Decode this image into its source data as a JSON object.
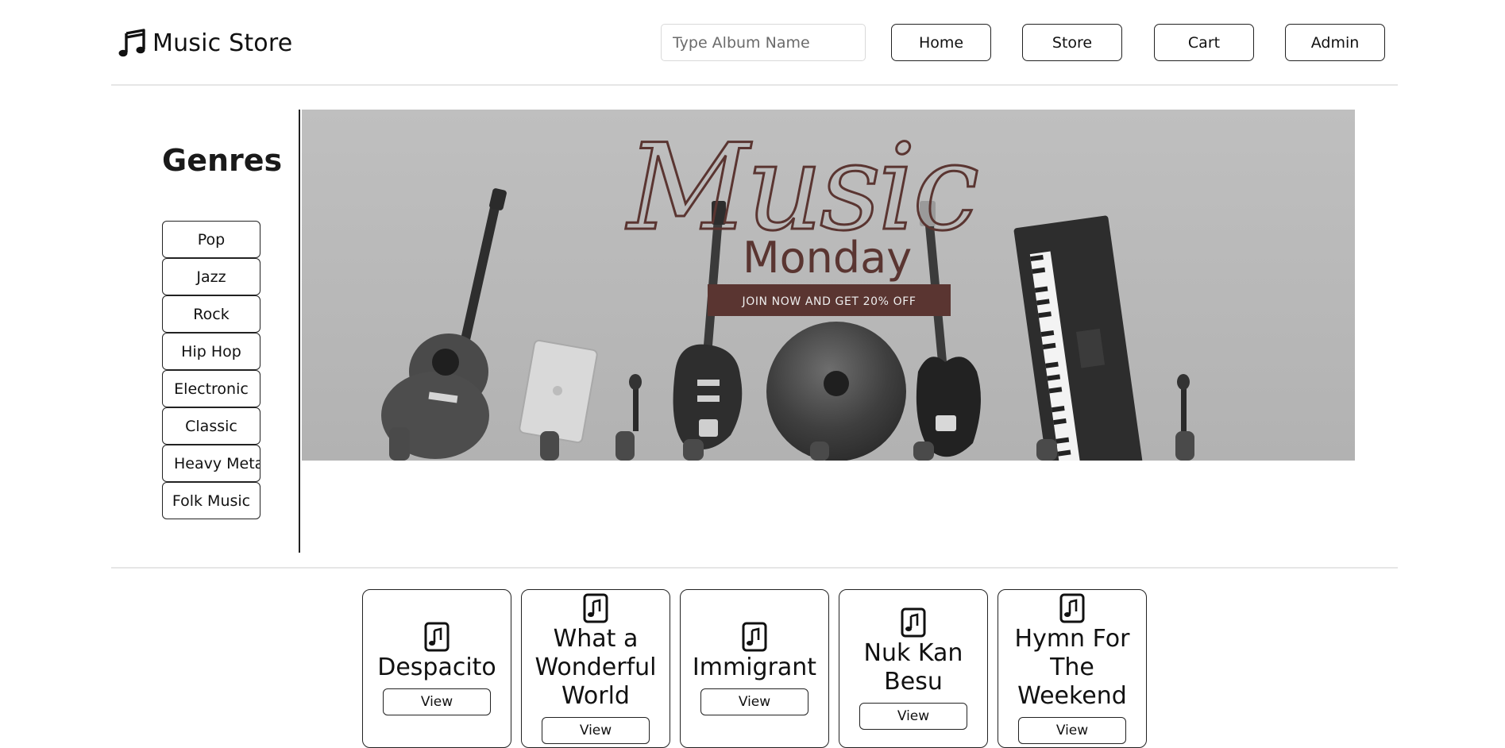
{
  "brand": {
    "name": "Music Store",
    "icon": "music-note-icon"
  },
  "search": {
    "placeholder": "Type Album Name"
  },
  "nav": {
    "home": "Home",
    "store": "Store",
    "cart": "Cart",
    "admin": "Admin"
  },
  "sidebar": {
    "title": "Genres",
    "genres": [
      "Pop",
      "Jazz",
      "Rock",
      "Hip Hop",
      "Electronic",
      "Classic",
      "Heavy Metal",
      "Folk Music"
    ]
  },
  "banner": {
    "script_text": "Music",
    "title": "Monday",
    "cta": "JOIN NOW AND GET 20% OFF"
  },
  "albums": [
    {
      "title": "Despacito",
      "icon": "music-file-icon",
      "button": "View"
    },
    {
      "title": "What a Wonderful World",
      "icon": "music-file-icon",
      "button": "View"
    },
    {
      "title": "Immigrant",
      "icon": "music-file-icon",
      "button": "View"
    },
    {
      "title": "Nuk Kan Besu",
      "icon": "music-file-icon",
      "button": "View"
    },
    {
      "title": "Hymn For The Weekend",
      "icon": "music-file-icon",
      "button": "View"
    }
  ],
  "colors": {
    "banner_bg": "#b9b9b9",
    "banner_accent": "#5a3531",
    "border": "#222222",
    "divider": "#e6e6e6"
  }
}
